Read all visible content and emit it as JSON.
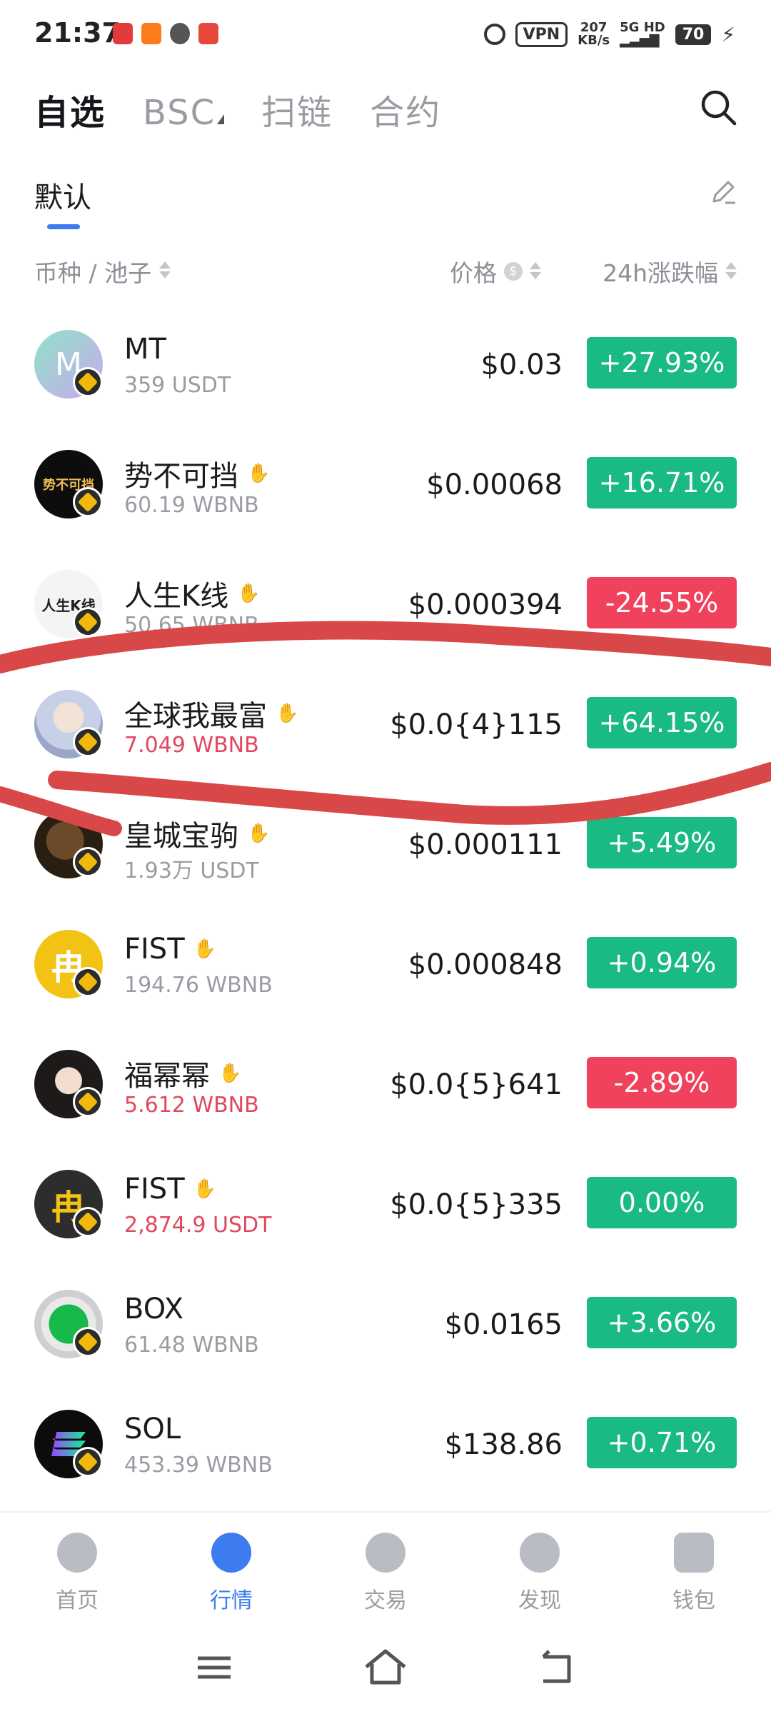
{
  "status_bar": {
    "time": "21:37",
    "vpn": "VPN",
    "speed_value": "207",
    "speed_unit": "KB/s",
    "network": "5G HD",
    "battery": "70"
  },
  "top_tabs": [
    {
      "label": "自选",
      "active": true
    },
    {
      "label": "BSC",
      "active": false
    },
    {
      "label": "扫链",
      "active": false
    },
    {
      "label": "合约",
      "active": false
    }
  ],
  "sub_tab": {
    "label": "默认"
  },
  "columns": {
    "name": "币种 / 池子",
    "price": "价格",
    "price_unit_icon": "$",
    "change": "24h涨跌幅"
  },
  "tokens": [
    {
      "name": "MT",
      "volume": "359 USDT",
      "volume_red": false,
      "price": "$0.03",
      "change": "+27.93%",
      "direction": "up",
      "hand": false,
      "avatar": "mt-gradient"
    },
    {
      "name": "势不可挡",
      "volume": "60.19 WBNB",
      "volume_red": false,
      "price": "$0.00068",
      "change": "+16.71%",
      "direction": "up",
      "hand": true,
      "avatar": "black-text-logo"
    },
    {
      "name": "人生K线",
      "volume": "50.65 WBNB",
      "volume_red": false,
      "price": "$0.000394",
      "change": "-24.55%",
      "direction": "down",
      "hand": true,
      "avatar": "white-text-logo"
    },
    {
      "name": "全球我最富",
      "volume": "7.049 WBNB",
      "volume_red": true,
      "price": "$0.0{4}115",
      "change": "+64.15%",
      "direction": "up",
      "hand": true,
      "avatar": "portrait"
    },
    {
      "name": "皇城宝驹",
      "volume": "1.93万 USDT",
      "volume_red": false,
      "price": "$0.000111",
      "change": "+5.49%",
      "direction": "up",
      "hand": true,
      "avatar": "horse"
    },
    {
      "name": "FIST",
      "volume": "194.76 WBNB",
      "volume_red": false,
      "price": "$0.000848",
      "change": "+0.94%",
      "direction": "up",
      "hand": true,
      "avatar": "fist-yellow"
    },
    {
      "name": "福幂幂",
      "volume": "5.612 WBNB",
      "volume_red": true,
      "price": "$0.0{5}641",
      "change": "-2.89%",
      "direction": "down",
      "hand": true,
      "avatar": "portrait-woman"
    },
    {
      "name": "FIST",
      "volume": "2,874.9 USDT",
      "volume_red": true,
      "price": "$0.0{5}335",
      "change": "0.00%",
      "direction": "up",
      "hand": true,
      "avatar": "fist-dark"
    },
    {
      "name": "BOX",
      "volume": "61.48 WBNB",
      "volume_red": false,
      "price": "$0.0165",
      "change": "+3.66%",
      "direction": "up",
      "hand": false,
      "avatar": "box-green"
    },
    {
      "name": "SOL",
      "volume": "453.39 WBNB",
      "volume_red": false,
      "price": "$138.86",
      "change": "+0.71%",
      "direction": "up",
      "hand": false,
      "avatar": "sol"
    }
  ],
  "bottom_nav": [
    {
      "label": "首页",
      "icon": "home-icon",
      "active": false
    },
    {
      "label": "行情",
      "icon": "market-trend-icon",
      "active": true
    },
    {
      "label": "交易",
      "icon": "swap-icon",
      "active": false
    },
    {
      "label": "发现",
      "icon": "compass-icon",
      "active": false
    },
    {
      "label": "钱包",
      "icon": "wallet-icon",
      "active": false
    }
  ],
  "colors": {
    "up": "#1aba83",
    "down": "#f1425d",
    "accent": "#3c7cf0",
    "annotation": "#d94848"
  }
}
